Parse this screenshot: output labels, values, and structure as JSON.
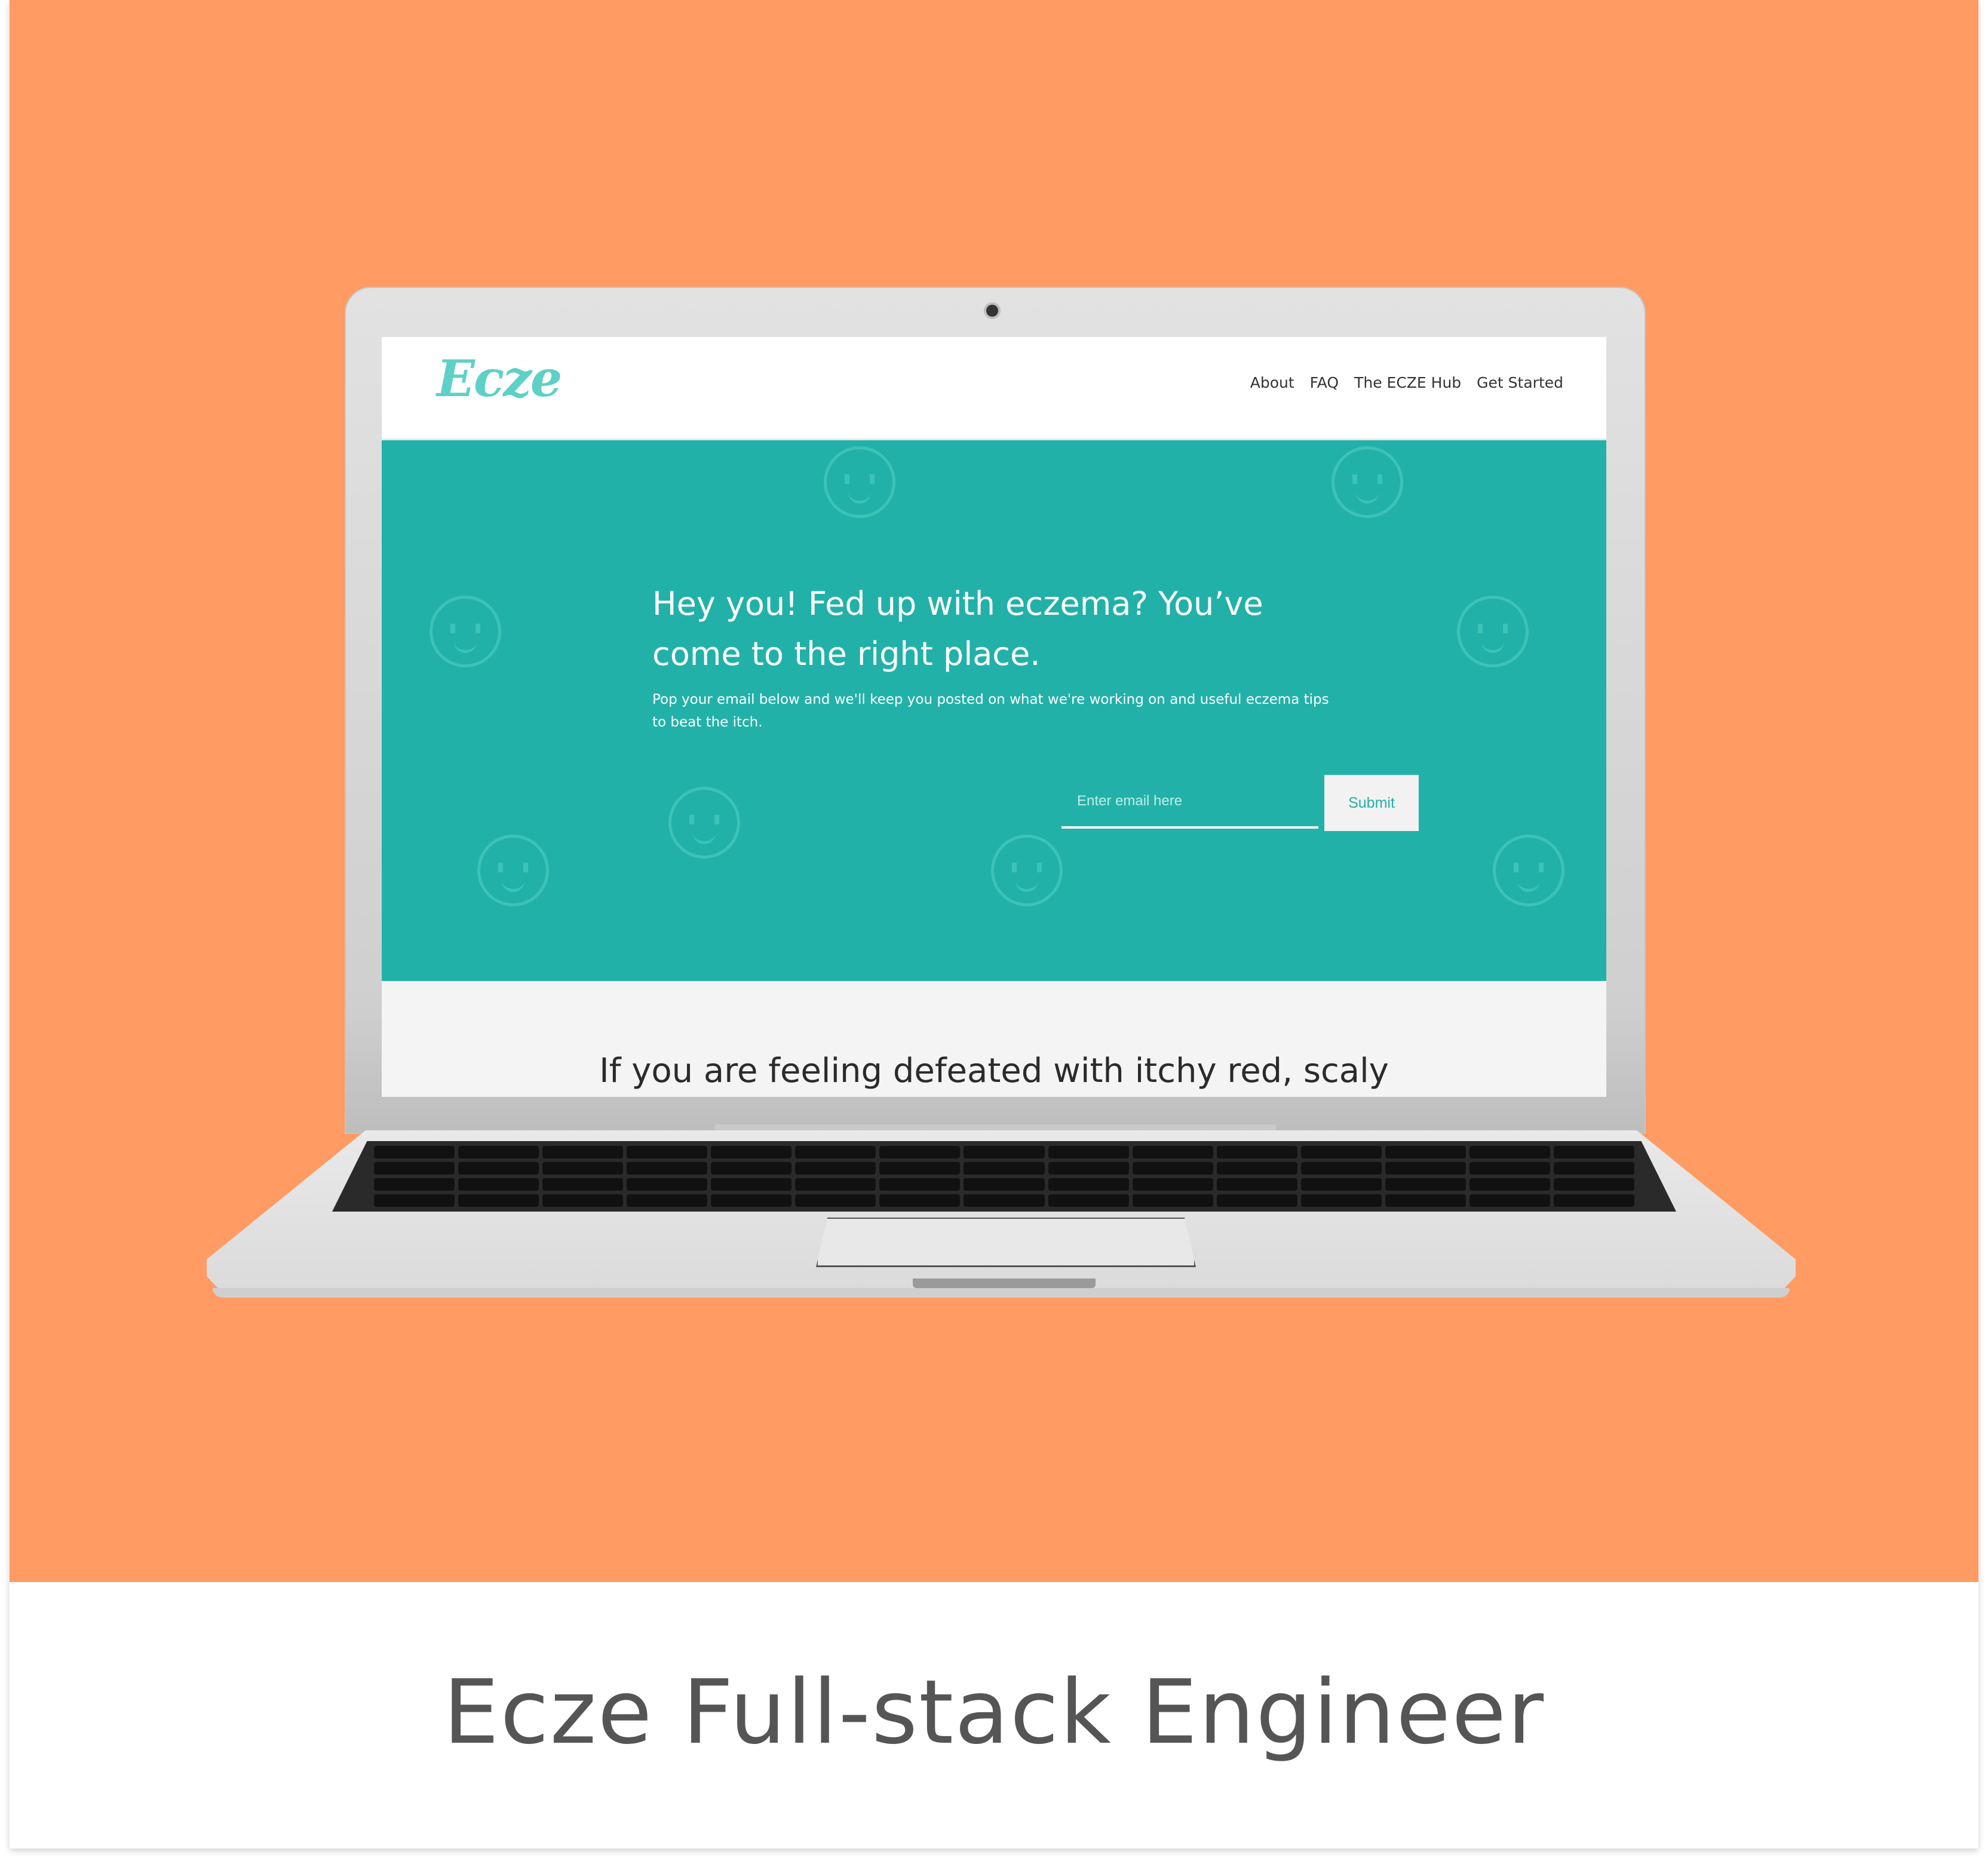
{
  "site": {
    "logo": "Ecze",
    "nav": [
      "About",
      "FAQ",
      "The ECZE Hub",
      "Get Started"
    ]
  },
  "hero": {
    "title": "Hey you! Fed up with eczema? You’ve come to the right place.",
    "subtitle": "Pop your email below and we'll keep you posted on what we're working on and useful eczema tips to beat the itch.",
    "email_placeholder": "Enter email here",
    "submit_label": "Submit"
  },
  "section": {
    "heading": "If you are feeling defeated with itchy red, scaly"
  },
  "caption": "Ecze Full-stack Engineer",
  "colors": {
    "banner": "#ff9b63",
    "hero": "#22b1a9",
    "logo": "#5fd0c7"
  }
}
